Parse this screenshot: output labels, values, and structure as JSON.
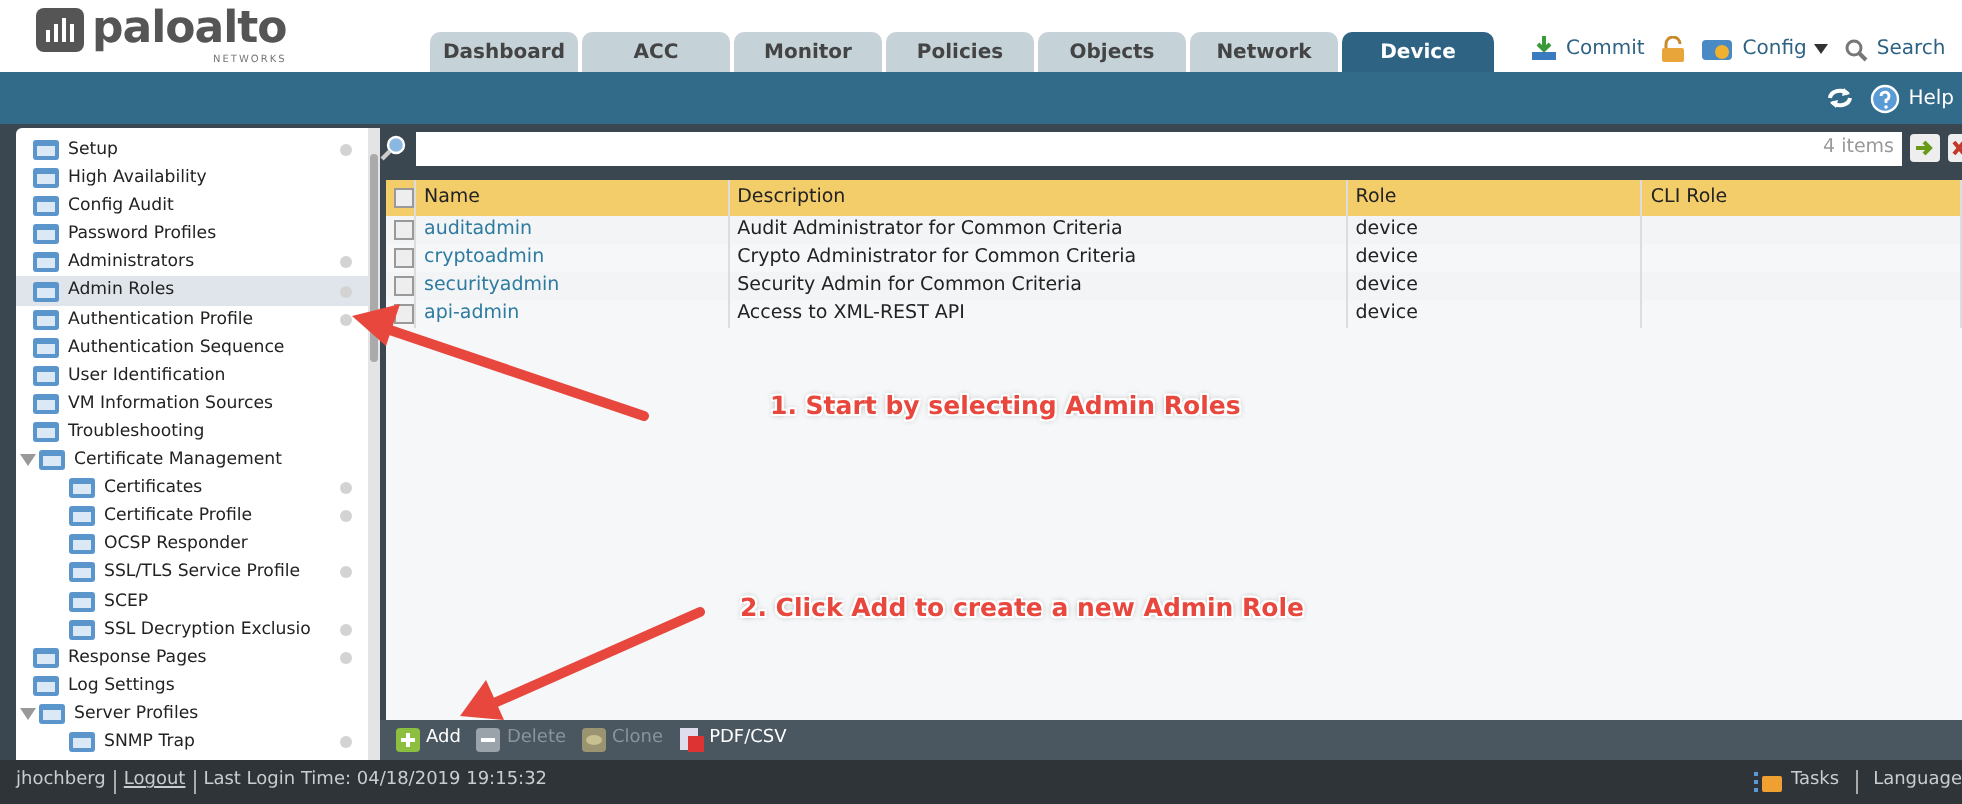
{
  "header": {
    "logo": {
      "name": "paloalto",
      "subtitle": "NETWORKS"
    },
    "tabs": [
      {
        "label": "Dashboard",
        "selected": false
      },
      {
        "label": "ACC",
        "selected": false
      },
      {
        "label": "Monitor",
        "selected": false
      },
      {
        "label": "Policies",
        "selected": false
      },
      {
        "label": "Objects",
        "selected": false
      },
      {
        "label": "Network",
        "selected": false
      },
      {
        "label": "Device",
        "selected": true
      }
    ],
    "actions": [
      {
        "kind": "commit",
        "label": "Commit"
      },
      {
        "kind": "lock"
      },
      {
        "kind": "config",
        "label": "Config"
      },
      {
        "kind": "search",
        "label": "Search"
      }
    ]
  },
  "subbar": {
    "help": "Help"
  },
  "sidebar": {
    "items": [
      {
        "label": "Setup",
        "marker": true,
        "selected": false
      },
      {
        "label": "High Availability",
        "marker": false,
        "selected": false
      },
      {
        "label": "Config Audit",
        "marker": false,
        "selected": false
      },
      {
        "label": "Password Profiles",
        "marker": false,
        "selected": false
      },
      {
        "label": "Administrators",
        "marker": true,
        "selected": false
      },
      {
        "label": "Admin Roles",
        "marker": true,
        "selected": true
      },
      {
        "label": "Authentication Profile",
        "marker": true,
        "selected": false
      },
      {
        "label": "Authentication Sequence",
        "marker": false,
        "selected": false
      },
      {
        "label": "User Identification",
        "marker": false,
        "selected": false
      },
      {
        "label": "VM Information Sources",
        "marker": false,
        "selected": false
      },
      {
        "label": "Troubleshooting",
        "marker": false,
        "selected": false
      },
      {
        "label": "Certificate Management",
        "marker": false,
        "selected": false,
        "expanded": true,
        "children": [
          {
            "label": "Certificates",
            "marker": true,
            "selected": false
          },
          {
            "label": "Certificate Profile",
            "marker": true,
            "selected": false
          },
          {
            "label": "OCSP Responder",
            "marker": false,
            "selected": false
          },
          {
            "label": "SSL/TLS Service Profile",
            "marker": true,
            "selected": false
          },
          {
            "label": "SCEP",
            "marker": false,
            "selected": false
          },
          {
            "label": "SSL Decryption Exclusio",
            "marker": true,
            "selected": false
          }
        ]
      },
      {
        "label": "Response Pages",
        "marker": true,
        "selected": false
      },
      {
        "label": "Log Settings",
        "marker": false,
        "selected": false
      },
      {
        "label": "Server Profiles",
        "marker": false,
        "selected": false,
        "expanded": true,
        "children": [
          {
            "label": "SNMP Trap",
            "marker": true,
            "selected": false
          }
        ]
      }
    ]
  },
  "search": {
    "count": "4 items"
  },
  "table": {
    "select_all_checked": false,
    "columns": [
      "Name",
      "Description",
      "Role",
      "CLI Role"
    ],
    "rows": [
      {
        "name": "auditadmin",
        "description": "Audit Administrator for Common Criteria",
        "role": "device",
        "checked": false
      },
      {
        "name": "cryptoadmin",
        "description": "Crypto Administrator for Common Criteria",
        "role": "device",
        "checked": false
      },
      {
        "name": "securityadmin",
        "description": "Security Admin for Common Criteria",
        "role": "device",
        "checked": false
      },
      {
        "name": "api-admin",
        "description": "Access to XML-REST API",
        "role": "device",
        "checked": false
      }
    ]
  },
  "actions": [
    {
      "kind": "add",
      "label": "Add",
      "disabled": false
    },
    {
      "kind": "delete",
      "label": "Delete",
      "disabled": true
    },
    {
      "kind": "clone",
      "label": "Clone",
      "disabled": true
    },
    {
      "kind": "pdf",
      "label": "PDF/CSV",
      "disabled": false
    }
  ],
  "status_bar": {
    "user": "jhochberg",
    "logout": "Logout",
    "last_login": "Last Login Time: 04/18/2019 19:15:32",
    "tasks": "Tasks",
    "language": "Language"
  },
  "annotations": [
    {
      "text": "1. Start by selecting Admin Roles"
    },
    {
      "text": "2. Click Add to create a new Admin Role"
    }
  ]
}
